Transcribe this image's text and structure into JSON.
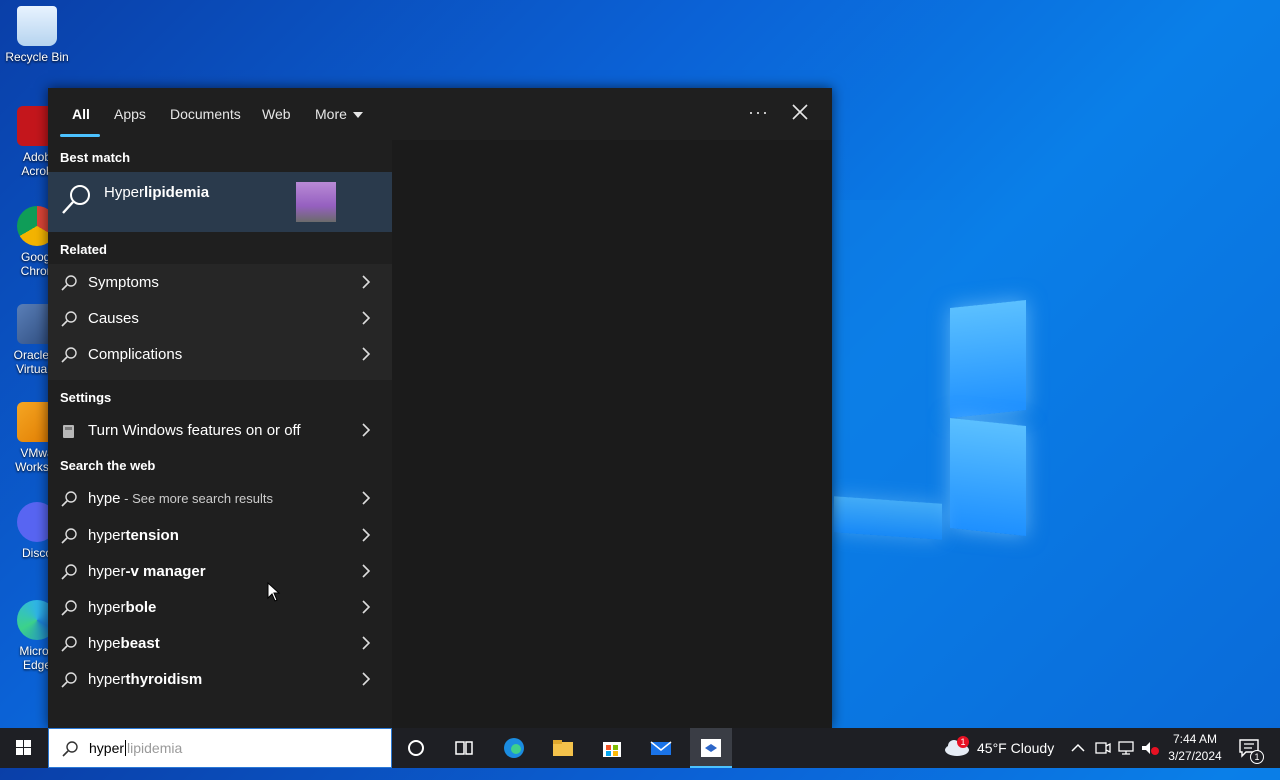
{
  "desktop": {
    "icons": [
      {
        "label": "Recycle Bin"
      },
      {
        "label": "Adob\nAcrob"
      },
      {
        "label": "Googl\nChron"
      },
      {
        "label": "Oracle V\nVirtualB"
      },
      {
        "label": "VMwa\nWorksta"
      },
      {
        "label": "Disco"
      },
      {
        "label": "Micros\nEdge"
      }
    ]
  },
  "search": {
    "tabs": [
      "All",
      "Apps",
      "Documents",
      "Web",
      "More"
    ],
    "best_match_title": "Best match",
    "best_match": {
      "prefix": "Hyper",
      "bold": "lipidemia"
    },
    "related_title": "Related",
    "related": [
      "Symptoms",
      "Causes",
      "Complications"
    ],
    "settings_title": "Settings",
    "settings": [
      "Turn Windows features on or off"
    ],
    "web_title": "Search the web",
    "web_first": {
      "term": "hype",
      "sub": " - See more search results"
    },
    "web": [
      {
        "prefix": "hyper",
        "bold": "tension"
      },
      {
        "prefix": "hyper",
        "bold": "-v manager"
      },
      {
        "prefix": "hyper",
        "bold": "bole"
      },
      {
        "prefix": "hype",
        "bold": "beast"
      },
      {
        "prefix": "hyper",
        "bold": "thyroidism"
      }
    ]
  },
  "taskbar": {
    "search_typed": "hyper",
    "search_ghost": "lipidemia",
    "weather": "45°F  Cloudy",
    "weather_badge": "1",
    "time": "7:44 AM",
    "date": "3/27/2024",
    "notif_count": "1"
  },
  "colors": {
    "accent": "#4cc2ff",
    "selected": "#2a3a4c",
    "panel": "#1f1f1f"
  }
}
